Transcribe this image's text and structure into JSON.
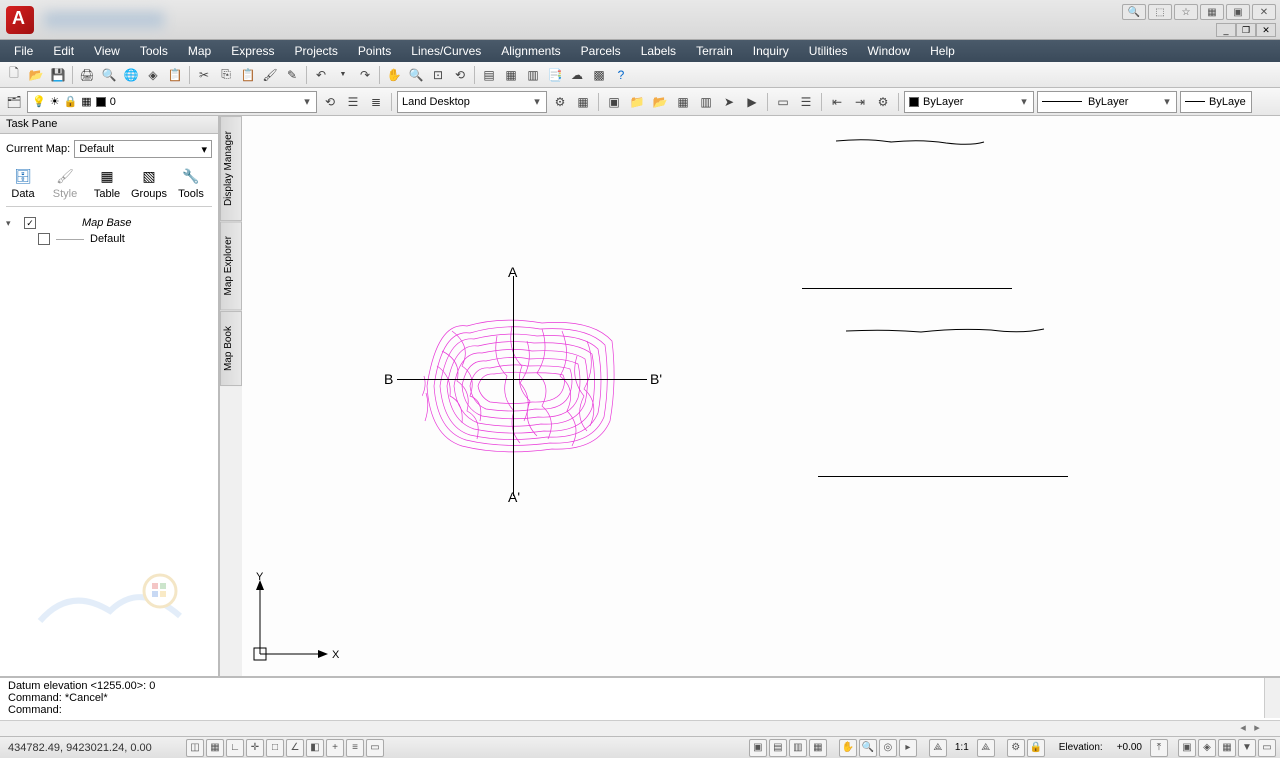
{
  "titlebar": {
    "icons": {
      "search": "🔍",
      "tool1": "⬚",
      "star": "☆",
      "tool2": "▦",
      "tool3": "▣",
      "close": "✕"
    },
    "win": {
      "min": "_",
      "max": "❐",
      "close": "✕"
    }
  },
  "menu": [
    "File",
    "Edit",
    "View",
    "Tools",
    "Map",
    "Express",
    "Projects",
    "Points",
    "Lines/Curves",
    "Alignments",
    "Parcels",
    "Labels",
    "Terrain",
    "Inquiry",
    "Utilities",
    "Window",
    "Help"
  ],
  "toolbar2": {
    "layer_combo": {
      "value": "0",
      "icons": [
        "💡",
        "☀",
        "🔒",
        "▦"
      ]
    },
    "workspace": "Land Desktop",
    "color_combo": "ByLayer",
    "linetype_combo": "ByLayer",
    "lineweight_combo": "ByLaye"
  },
  "taskpane": {
    "title": "Task Pane",
    "current_map_label": "Current Map:",
    "current_map_value": "Default",
    "tabs": [
      {
        "label": "Data",
        "icon": "🗄"
      },
      {
        "label": "Style",
        "icon": "🖌"
      },
      {
        "label": "Table",
        "icon": "▦"
      },
      {
        "label": "Groups",
        "icon": "▧"
      },
      {
        "label": "Tools",
        "icon": "🔧"
      }
    ],
    "tree": {
      "root": {
        "label": "Map Base",
        "checked": true
      },
      "child": {
        "label": "Default",
        "checked": false
      }
    }
  },
  "vtabs": [
    "Display Manager",
    "Map Explorer",
    "Map Book"
  ],
  "canvas": {
    "labels": {
      "A": "A",
      "Ap": "A'",
      "B": "B",
      "Bp": "B'",
      "X": "X",
      "Y": "Y"
    }
  },
  "cmdline": {
    "line1": "Datum elevation <1255.00>: 0",
    "line2": "Command: *Cancel*",
    "line3": "Command:"
  },
  "statusbar": {
    "coords": "434782.49, 9423021.24, 0.00",
    "scale": "1:1",
    "elevation_label": "Elevation:",
    "elevation_value": "+0.00"
  }
}
